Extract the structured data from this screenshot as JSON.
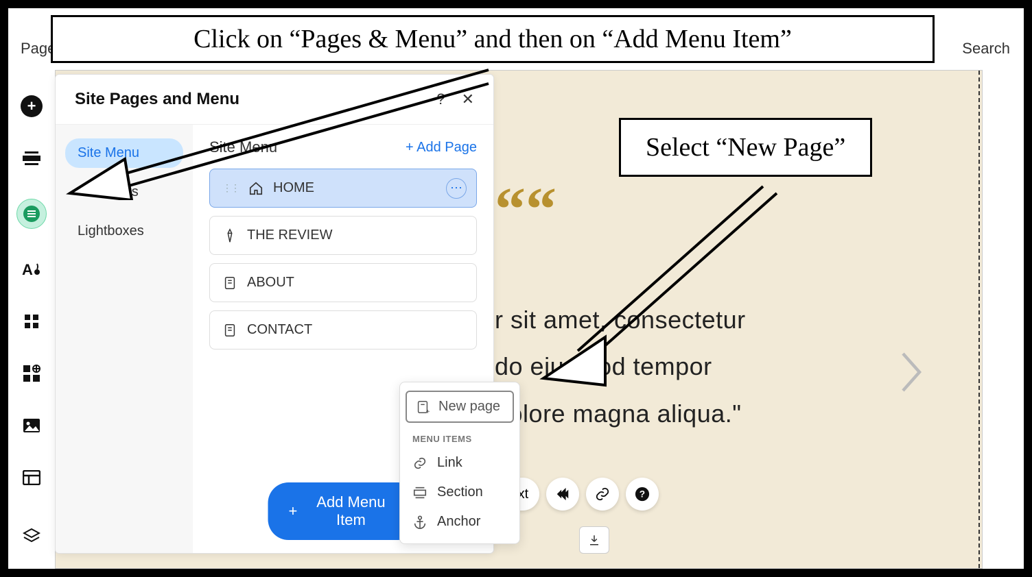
{
  "topbar": {
    "pages": "Pages",
    "search": "Search"
  },
  "panel": {
    "title": "Site Pages and Menu",
    "left": {
      "site_menu": "Site Menu",
      "pages": "Pages",
      "lightboxes": "Lightboxes"
    },
    "right": {
      "heading": "Site Menu",
      "add_page": "+  Add Page",
      "items": [
        {
          "label": "HOME",
          "icon": "home",
          "selected": true
        },
        {
          "label": "THE REVIEW",
          "icon": "pen",
          "selected": false
        },
        {
          "label": "ABOUT",
          "icon": "page",
          "selected": false
        },
        {
          "label": "CONTACT",
          "icon": "page",
          "selected": false
        }
      ],
      "add_menu_item": "Add Menu Item"
    }
  },
  "popover": {
    "new_page": "New page",
    "section_label": "MENU ITEMS",
    "link": "Link",
    "section": "Section",
    "anchor": "Anchor"
  },
  "canvas": {
    "quote_mark": "““",
    "line1": "r sit amet, consectetur",
    "line2": "do eiusmod tempor",
    "line3": "dolore magna aliqua.\"",
    "edit_text": "Text"
  },
  "callouts": {
    "c1": "Click on “Pages & Menu” and then on “Add Menu Item”",
    "c2": "Select “New Page”"
  }
}
